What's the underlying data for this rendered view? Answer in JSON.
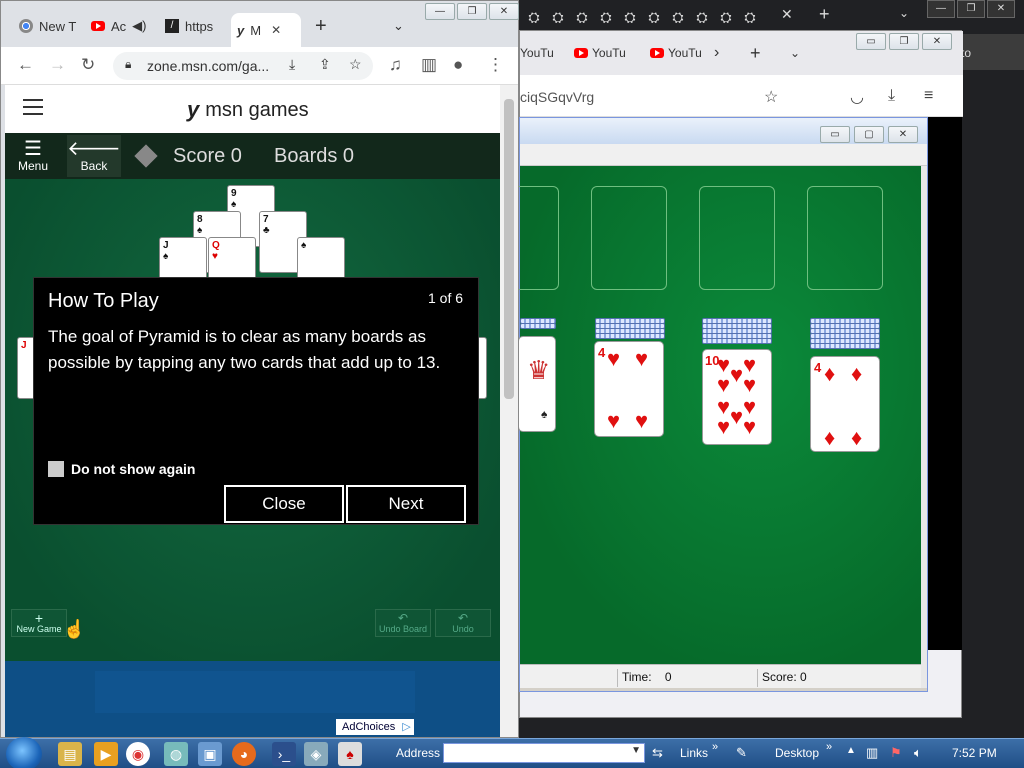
{
  "chrome_back": {
    "right_label": "to",
    "newtab": "+",
    "tabclose": "✕"
  },
  "firefox": {
    "tabs": [
      {
        "label": "YouTu"
      },
      {
        "label": "YouTu"
      },
      {
        "label": "YouTu"
      }
    ],
    "url_fragment": "ciqSGqvVrg"
  },
  "solitaire": {
    "status_time_label": "Time:",
    "status_time_value": "0",
    "status_score_label": "Score:",
    "status_score_value": "0",
    "cards": [
      {
        "rank": "4",
        "suit": "♥"
      },
      {
        "rank": "10",
        "suit": "♥"
      },
      {
        "rank": "4",
        "suit": "♦"
      }
    ]
  },
  "chrome_front": {
    "tabs": [
      {
        "label": "New T"
      },
      {
        "label": "Ac"
      },
      {
        "label": "https"
      },
      {
        "label": "M"
      }
    ],
    "url": "zone.msn.com/ga..."
  },
  "msn": {
    "logo": "msn games",
    "menu_label": "Menu",
    "back_label": "Back",
    "score": "Score 0",
    "boards": "Boards 0",
    "new_game": "New Game",
    "undo_board": "Undo Board",
    "undo": "Undo",
    "adchoices": "AdChoices"
  },
  "dialog": {
    "title": "How To Play",
    "count": "1 of 6",
    "body": "The goal of Pyramid is to clear as many boards as possible by tapping any two cards that add up to 13.",
    "checkbox_label": "Do not show again",
    "close_label": "Close",
    "next_label": "Next"
  },
  "taskbar": {
    "address_label": "Address",
    "links_label": "Links",
    "desktop_label": "Desktop",
    "clock": "7:52 PM"
  }
}
